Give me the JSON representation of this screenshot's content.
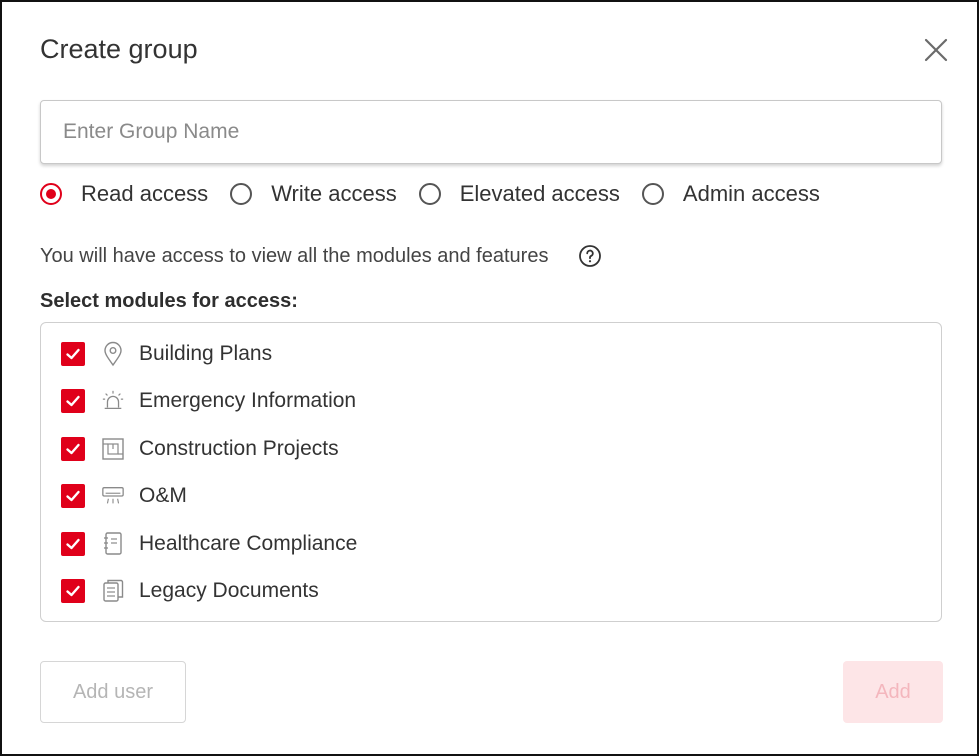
{
  "dialog": {
    "title": "Create group",
    "close_icon": "close-icon"
  },
  "group_name": {
    "placeholder": "Enter Group Name",
    "value": ""
  },
  "access": {
    "options": [
      {
        "label": "Read access",
        "checked": true
      },
      {
        "label": "Write access",
        "checked": false
      },
      {
        "label": "Elevated access",
        "checked": false
      },
      {
        "label": "Admin access",
        "checked": false
      }
    ],
    "description": "You will have access to view all the modules and features",
    "help_icon": "help-circle-icon"
  },
  "modules": {
    "heading": "Select modules for access:",
    "items": [
      {
        "label": "Building Plans",
        "icon": "location-pin-icon",
        "checked": true
      },
      {
        "label": "Emergency Information",
        "icon": "alarm-light-icon",
        "checked": true
      },
      {
        "label": "Construction Projects",
        "icon": "floor-plan-icon",
        "checked": true
      },
      {
        "label": "O&M",
        "icon": "air-conditioner-icon",
        "checked": true
      },
      {
        "label": "Healthcare Compliance",
        "icon": "notebook-icon",
        "checked": true
      },
      {
        "label": "Legacy Documents",
        "icon": "documents-icon",
        "checked": true
      }
    ]
  },
  "footer": {
    "add_user_label": "Add user",
    "add_label": "Add"
  },
  "colors": {
    "accent": "#e0001a",
    "disabled_primary_bg": "#fde5e7",
    "disabled_primary_text": "#f4b6bd"
  }
}
